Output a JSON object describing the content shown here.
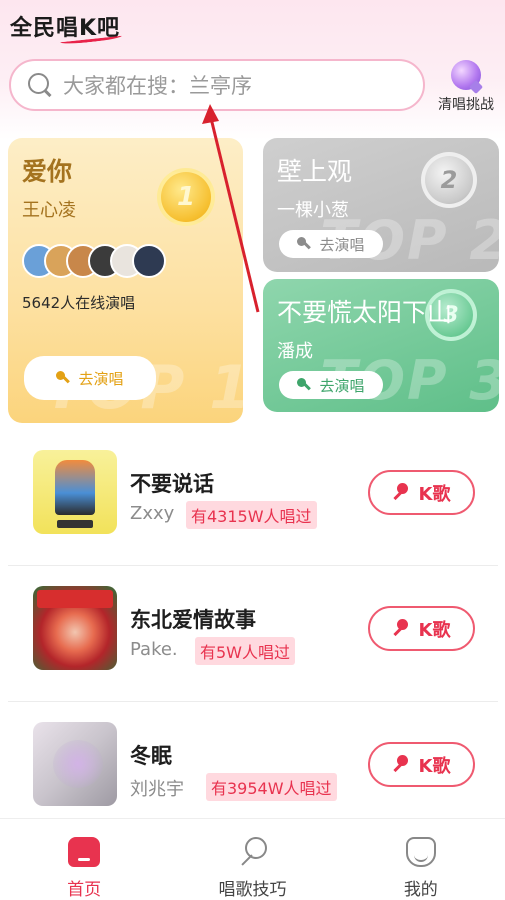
{
  "app": {
    "brand": "全民唱K吧"
  },
  "search": {
    "placeholder": "大家都在搜：兰亭序"
  },
  "challenge": {
    "label": "清唱挑战",
    "icon": "purple-orb-icon"
  },
  "top_cards": [
    {
      "rank": "1",
      "title": "爱你",
      "artist": "王心凌",
      "online": "5642人在线演唱",
      "button": "去演唱",
      "watermark": "TOP 1"
    },
    {
      "rank": "2",
      "title": "壁上观",
      "artist": "一棵小葱",
      "button": "去演唱",
      "watermark": "TOP 2"
    },
    {
      "rank": "3",
      "title": "不要慌太阳下山",
      "artist": "潘成",
      "button": "去演唱",
      "watermark": "TOP 3"
    }
  ],
  "songs": [
    {
      "title": "不要说话",
      "artist": "Zxxy",
      "sung": "有4315W人唱过",
      "button": "K歌"
    },
    {
      "title": "东北爱情故事",
      "artist": "Pake.",
      "sung": "有5W人唱过",
      "button": "K歌"
    },
    {
      "title": "冬眠",
      "artist": "刘兆宇",
      "sung": "有3954W人唱过",
      "button": "K歌"
    }
  ],
  "tabs": [
    {
      "label": "首页",
      "active": true,
      "icon": "home-icon"
    },
    {
      "label": "唱歌技巧",
      "active": false,
      "icon": "microphone-icon"
    },
    {
      "label": "我的",
      "active": false,
      "icon": "profile-icon"
    }
  ],
  "colors": {
    "accent": "#e8334f",
    "gold": "#fbd47c",
    "silver": "#b9b9b9",
    "green": "#5fbf89"
  }
}
